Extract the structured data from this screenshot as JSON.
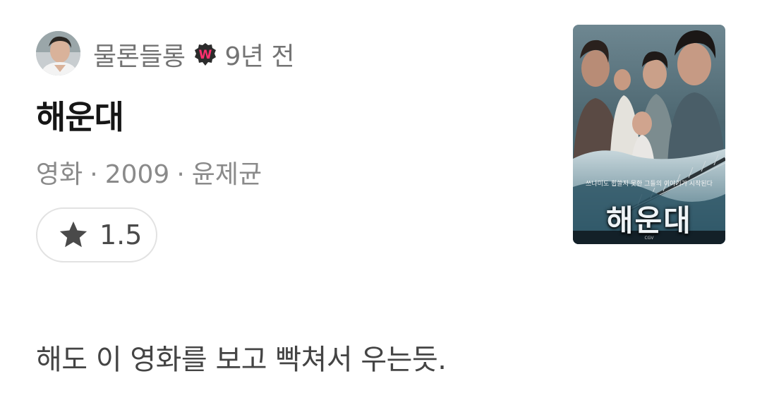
{
  "user": {
    "name": "물론들롱",
    "badge_letter": "W",
    "time_ago": "9년 전"
  },
  "movie": {
    "title": "해운대",
    "category": "영화",
    "year": "2009",
    "director": "윤제균",
    "separator": "·",
    "rating": "1.5",
    "poster": {
      "title_text": "해운대",
      "tagline": "쓰나미도 휩쓸지 못한 그들의 이야기가 시작된다"
    }
  },
  "comment": "해도 이 영화를 보고 빡쳐서 우는듯.",
  "colors": {
    "badge_bg": "#2b2b2b",
    "badge_letter": "#ff2f6e",
    "star": "#4a4a4a"
  },
  "icons": {
    "badge": "watcha-badge-icon",
    "star": "star-icon"
  }
}
